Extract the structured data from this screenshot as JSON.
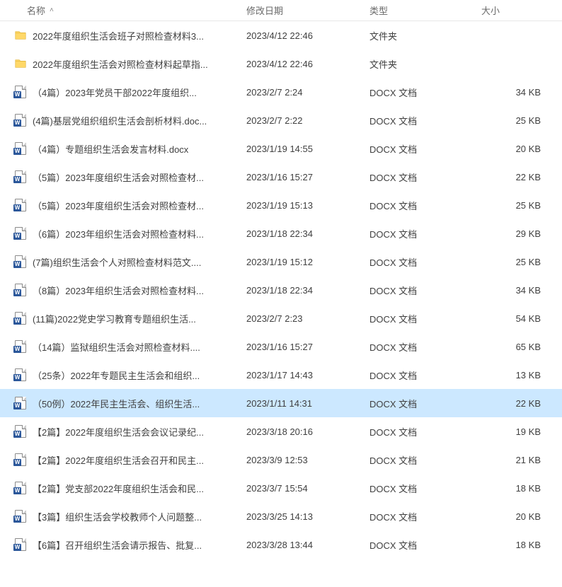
{
  "columns": {
    "name": "名称",
    "date": "修改日期",
    "type": "类型",
    "size": "大小"
  },
  "type_labels": {
    "folder": "文件夹",
    "docx": "DOCX 文档"
  },
  "icon_glyphs": {
    "word": "W"
  },
  "selected_index": 13,
  "rows": [
    {
      "icon": "folder",
      "name": "2022年度组织生活会班子对照检查材料3...",
      "date": "2023/4/12 22:46",
      "type_key": "folder",
      "size": ""
    },
    {
      "icon": "folder",
      "name": "2022年度组织生活会对照检查材料起草指...",
      "date": "2023/4/12 22:46",
      "type_key": "folder",
      "size": ""
    },
    {
      "icon": "word",
      "name": "（4篇）2023年党员干部2022年度组织...",
      "date": "2023/2/7 2:24",
      "type_key": "docx",
      "size": "34 KB"
    },
    {
      "icon": "word",
      "name": "(4篇)基层党组织组织生活会剖析材料.doc...",
      "date": "2023/2/7 2:22",
      "type_key": "docx",
      "size": "25 KB"
    },
    {
      "icon": "word",
      "name": "（4篇）专题组织生活会发言材料.docx",
      "date": "2023/1/19 14:55",
      "type_key": "docx",
      "size": "20 KB"
    },
    {
      "icon": "word",
      "name": "（5篇）2023年度组织生活会对照检查材...",
      "date": "2023/1/16 15:27",
      "type_key": "docx",
      "size": "22 KB"
    },
    {
      "icon": "word",
      "name": "（5篇）2023年度组织生活会对照检查材...",
      "date": "2023/1/19 15:13",
      "type_key": "docx",
      "size": "25 KB"
    },
    {
      "icon": "word",
      "name": "（6篇）2023年组织生活会对照检查材料...",
      "date": "2023/1/18 22:34",
      "type_key": "docx",
      "size": "29 KB"
    },
    {
      "icon": "word",
      "name": "(7篇)组织生活会个人对照检查材料范文....",
      "date": "2023/1/19 15:12",
      "type_key": "docx",
      "size": "25 KB"
    },
    {
      "icon": "word",
      "name": "（8篇）2023年组织生活会对照检查材料...",
      "date": "2023/1/18 22:34",
      "type_key": "docx",
      "size": "34 KB"
    },
    {
      "icon": "word",
      "name": "(11篇)2022党史学习教育专题组织生活...",
      "date": "2023/2/7 2:23",
      "type_key": "docx",
      "size": "54 KB"
    },
    {
      "icon": "word",
      "name": "（14篇）监狱组织生活会对照检查材料....",
      "date": "2023/1/16 15:27",
      "type_key": "docx",
      "size": "65 KB"
    },
    {
      "icon": "word",
      "name": "（25条）2022年专题民主生活会和组织...",
      "date": "2023/1/17 14:43",
      "type_key": "docx",
      "size": "13 KB"
    },
    {
      "icon": "word",
      "name": "（50例）2022年民主生活会、组织生活...",
      "date": "2023/1/11 14:31",
      "type_key": "docx",
      "size": "22 KB"
    },
    {
      "icon": "word",
      "name": "【2篇】2022年度组织生活会会议记录纪...",
      "date": "2023/3/18 20:16",
      "type_key": "docx",
      "size": "19 KB"
    },
    {
      "icon": "word",
      "name": "【2篇】2022年度组织生活会召开和民主...",
      "date": "2023/3/9 12:53",
      "type_key": "docx",
      "size": "21 KB"
    },
    {
      "icon": "word",
      "name": "【2篇】党支部2022年度组织生活会和民...",
      "date": "2023/3/7 15:54",
      "type_key": "docx",
      "size": "18 KB"
    },
    {
      "icon": "word",
      "name": "【3篇】组织生活会学校教师个人问题整...",
      "date": "2023/3/25 14:13",
      "type_key": "docx",
      "size": "20 KB"
    },
    {
      "icon": "word",
      "name": "【6篇】召开组织生活会请示报告、批复...",
      "date": "2023/3/28 13:44",
      "type_key": "docx",
      "size": "18 KB"
    }
  ]
}
